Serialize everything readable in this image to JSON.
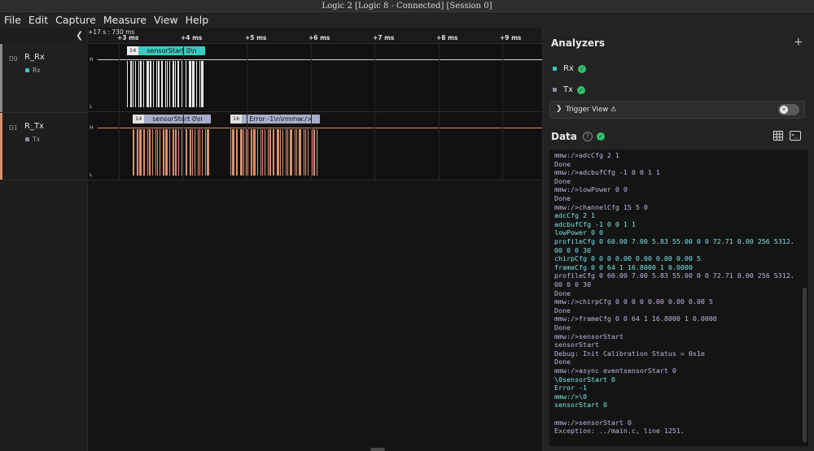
{
  "window": {
    "title": "Logic 2 [Logic 8 - Connected] [Session 0]"
  },
  "menu": [
    "File",
    "Edit",
    "Capture",
    "Measure",
    "View",
    "Help"
  ],
  "colors": {
    "rx": "#3fc8c0",
    "tx": "#d99070",
    "ok": "#2fc26e",
    "prompt_text": "#c3b3dc",
    "echo_text": "#7fe0e0"
  },
  "ruler": {
    "origin": "+17 s : 730 ms",
    "ticks": [
      "+3 ms",
      "+4 ms",
      "+5 ms",
      "+6 ms",
      "+7 ms",
      "+8 ms",
      "+9 ms"
    ]
  },
  "channels": [
    {
      "index": "D0",
      "name": "R_Rx",
      "analyzer_label": "Rx",
      "high": "H",
      "low": "L"
    },
    {
      "index": "D1",
      "name": "R_Tx",
      "analyzer_label": "Tx",
      "high": "H",
      "low": "L"
    }
  ],
  "protocol_frames": {
    "rx": [
      {
        "count": "14",
        "text": "sensorStart 0\\n"
      }
    ],
    "tx": [
      {
        "count": "14",
        "text": "sensorStart 0\\n"
      },
      {
        "count": "16",
        "text": "Error -1\\n\\rmmw:/>"
      }
    ]
  },
  "analyzers": {
    "title": "Analyzers",
    "add_icon": "plus-icon",
    "items": [
      {
        "name": "Rx"
      },
      {
        "name": "Tx"
      }
    ],
    "trigger_view": {
      "label": "Trigger View",
      "warning_icon": "warning-icon",
      "enabled": false
    }
  },
  "data_panel": {
    "title": "Data",
    "help_label": "?",
    "icons": [
      "grid-icon",
      "terminal-icon"
    ],
    "lines": [
      {
        "text": "mmw:/>adcCfg 2 1",
        "kind": "p"
      },
      {
        "text": "Done",
        "kind": "p"
      },
      {
        "text": "mmw:/>adcbufCfg -1 0 0 1 1",
        "kind": "p"
      },
      {
        "text": "Done",
        "kind": "p"
      },
      {
        "text": "mmw:/>lowPower 0 0",
        "kind": "p"
      },
      {
        "text": "Done",
        "kind": "p"
      },
      {
        "text": "mmw:/>channelCfg 15 5 0",
        "kind": "p"
      },
      {
        "text": "adcCfg 2 1",
        "kind": "e"
      },
      {
        "text": "adcbufCfg -1 0 0 1 1",
        "kind": "e"
      },
      {
        "text": "lowPower 0 0",
        "kind": "e"
      },
      {
        "text": "profileCfg 0 60.00 7.00 5.83 55.00 0 0 72.71 0.00 256 5312.",
        "kind": "e"
      },
      {
        "text": "00 0 0 30",
        "kind": "e"
      },
      {
        "text": "chirpCfg 0 0 0 0.00 0.00 0.00 0.00 5",
        "kind": "e"
      },
      {
        "text": "frameCfg 0 0 64 1 16.8000 1 0.0000",
        "kind": "e"
      },
      {
        "text": "profileCfg 0 60.00 7.00 5.83 55.00 0 0 72.71 0.00 256 5312.",
        "kind": "p"
      },
      {
        "text": "00 0 0 30",
        "kind": "p"
      },
      {
        "text": "Done",
        "kind": "p"
      },
      {
        "text": "mmw:/>chirpCfg 0 0 0 0 0.00 0.00 0.00 5",
        "kind": "p"
      },
      {
        "text": "Done",
        "kind": "p"
      },
      {
        "text": "mmw:/>frameCfg 0 0 64 1 16.8000 1 0.0000",
        "kind": "p"
      },
      {
        "text": "Done",
        "kind": "p"
      },
      {
        "text": "mmw:/>sensorStart",
        "kind": "p"
      },
      {
        "text": "sensorStart",
        "kind": "p"
      },
      {
        "text": "Debug: Init Calibration Status = 0x1e",
        "kind": "p"
      },
      {
        "text": "Done",
        "kind": "p"
      },
      {
        "text": "mmw:/>async eventsensorStart 0",
        "kind": "p"
      },
      {
        "text": "\\0sensorStart 0",
        "kind": "e"
      },
      {
        "text": "Error -1",
        "kind": "e"
      },
      {
        "text": "mmw:/>\\0",
        "kind": "e"
      },
      {
        "text": "sensorStart 0",
        "kind": "e"
      },
      {
        "text": "",
        "kind": "e"
      },
      {
        "text": "mmw:/>sensorStart 0",
        "kind": "p"
      },
      {
        "text": "Exception: ../main.c, line 1251.",
        "kind": "p"
      }
    ]
  }
}
